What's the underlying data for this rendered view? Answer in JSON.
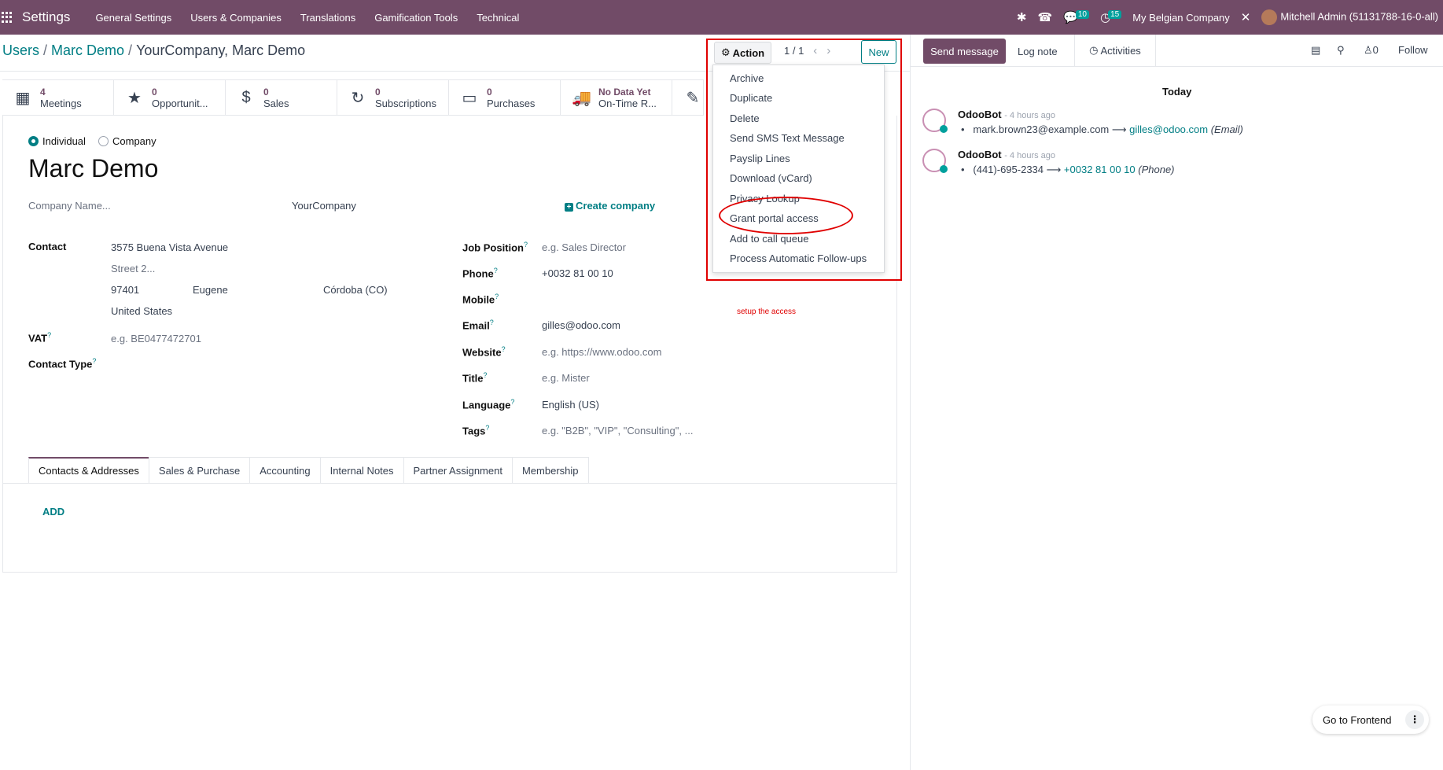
{
  "navbar": {
    "brand": "Settings",
    "menu": [
      "General Settings",
      "Users & Companies",
      "Translations",
      "Gamification Tools",
      "Technical"
    ],
    "messages_count": "10",
    "activities_count": "15",
    "company": "My Belgian Company",
    "user": "Mitchell Admin (51131788-16-0-all)"
  },
  "breadcrumb": {
    "users": "Users",
    "marc": "Marc Demo",
    "current": "YourCompany, Marc Demo"
  },
  "controls": {
    "action": "Action",
    "pager": "1 / 1",
    "new": "New"
  },
  "stats": [
    {
      "num": "4",
      "label": "Meetings",
      "icon": "calendar-icon"
    },
    {
      "num": "0",
      "label": "Opportunit...",
      "icon": "star-icon"
    },
    {
      "num": "0",
      "label": "Sales",
      "icon": "dollar-icon"
    },
    {
      "num": "0",
      "label": "Subscriptions",
      "icon": "refresh-icon"
    },
    {
      "num": "0",
      "label": "Purchases",
      "icon": "credit-card-icon"
    },
    {
      "num": "No Data Yet",
      "label": "On-Time R...",
      "icon": "truck-icon"
    }
  ],
  "form": {
    "type_individual": "Individual",
    "type_company": "Company",
    "name": "Marc Demo",
    "company_name_placeholder": "Company Name...",
    "company_value": "YourCompany",
    "create_company": "Create company",
    "contact_label": "Contact",
    "street": "3575  Buena Vista Avenue",
    "street2_placeholder": "Street 2...",
    "zip": "97401",
    "city": "Eugene",
    "state": "Córdoba (CO)",
    "country": "United States",
    "vat_label": "VAT",
    "vat_placeholder": "e.g. BE0477472701",
    "contact_type_label": "Contact Type",
    "job_label": "Job Position",
    "job_placeholder": "e.g. Sales Director",
    "phone_label": "Phone",
    "phone": "+0032 81 00 10",
    "mobile_label": "Mobile",
    "email_label": "Email",
    "email": "gilles@odoo.com",
    "website_label": "Website",
    "website_placeholder": "e.g. https://www.odoo.com",
    "title_label": "Title",
    "title_placeholder": "e.g. Mister",
    "language_label": "Language",
    "language": "English (US)",
    "tags_label": "Tags",
    "tags_placeholder": "e.g. \"B2B\", \"VIP\", \"Consulting\", ..."
  },
  "tabs": [
    "Contacts & Addresses",
    "Sales & Purchase",
    "Accounting",
    "Internal Notes",
    "Partner Assignment",
    "Membership"
  ],
  "add_label": "ADD",
  "action_menu": [
    "Archive",
    "Duplicate",
    "Delete",
    "Send SMS Text Message",
    "Payslip Lines",
    "Download (vCard)",
    "Privacy Lookup",
    "Grant portal access",
    "Add to call queue",
    "Process Automatic Follow-ups"
  ],
  "annotation_note": "setup the access",
  "chatter": {
    "send_message": "Send message",
    "log_note": "Log note",
    "activities": "Activities",
    "followers_count": "0",
    "follow": "Follow",
    "today": "Today",
    "messages": [
      {
        "author": "OdooBot",
        "time": "- 4 hours ago",
        "old": "mark.brown23@example.com",
        "new": "gilles@odoo.com",
        "kind": "(Email)"
      },
      {
        "author": "OdooBot",
        "time": "- 4 hours ago",
        "old": "(441)-695-2334",
        "new": "+0032 81 00 10",
        "kind": "(Phone)"
      }
    ]
  },
  "go_frontend": "Go to Frontend"
}
